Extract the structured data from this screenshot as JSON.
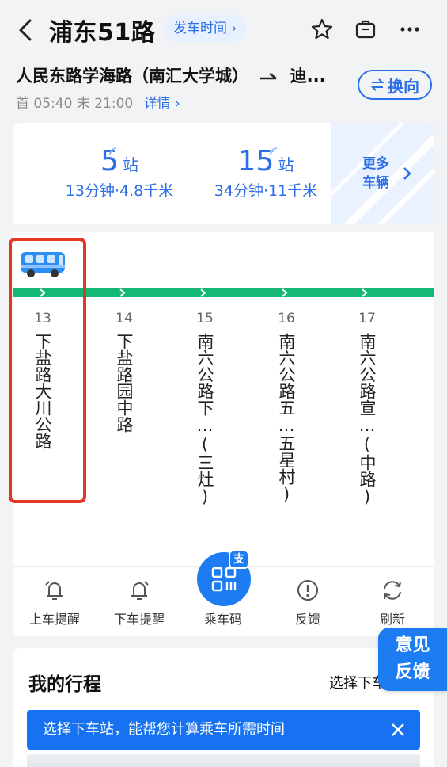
{
  "header": {
    "title": "浦东51路",
    "schedule_button": "发车时间"
  },
  "route": {
    "from": "人民东路学海路（南汇大学城）",
    "to": "迪...",
    "first_label": "首",
    "first_time": "05:40",
    "last_label": "末",
    "last_time": "21:00",
    "details_link": "详情",
    "swap_button": "换向"
  },
  "buses": [
    {
      "stops": "5",
      "unit": "站",
      "summary": "13分钟·4.8千米"
    },
    {
      "stops": "15",
      "unit": "站",
      "summary": "34分钟·11千米"
    }
  ],
  "more_vehicles": {
    "line1": "更多",
    "line2": "车辆"
  },
  "stops": [
    {
      "index": "13",
      "name": "下盐路大川公路"
    },
    {
      "index": "14",
      "name": "下盐路园中路"
    },
    {
      "index": "15",
      "name": "南六公路下…(三灶)"
    },
    {
      "index": "16",
      "name": "南六公路五…五星村)"
    },
    {
      "index": "17",
      "name": "南六公路宣…(中路)"
    }
  ],
  "actions": {
    "board_alert": "上车提醒",
    "alight_alert": "下车提醒",
    "ride_code": "乘车码",
    "ride_code_badge": "支",
    "feedback": "反馈",
    "refresh": "刷新"
  },
  "trip": {
    "title": "我的行程",
    "select_stop": "选择下车站",
    "toast": "选择下车站，能帮您计算乘车所需时间"
  },
  "floating_feedback": {
    "line1": "意见",
    "line2": "反馈"
  },
  "colors": {
    "accent": "#2b6ee8",
    "track": "#13b876",
    "highlight": "#e53525"
  }
}
